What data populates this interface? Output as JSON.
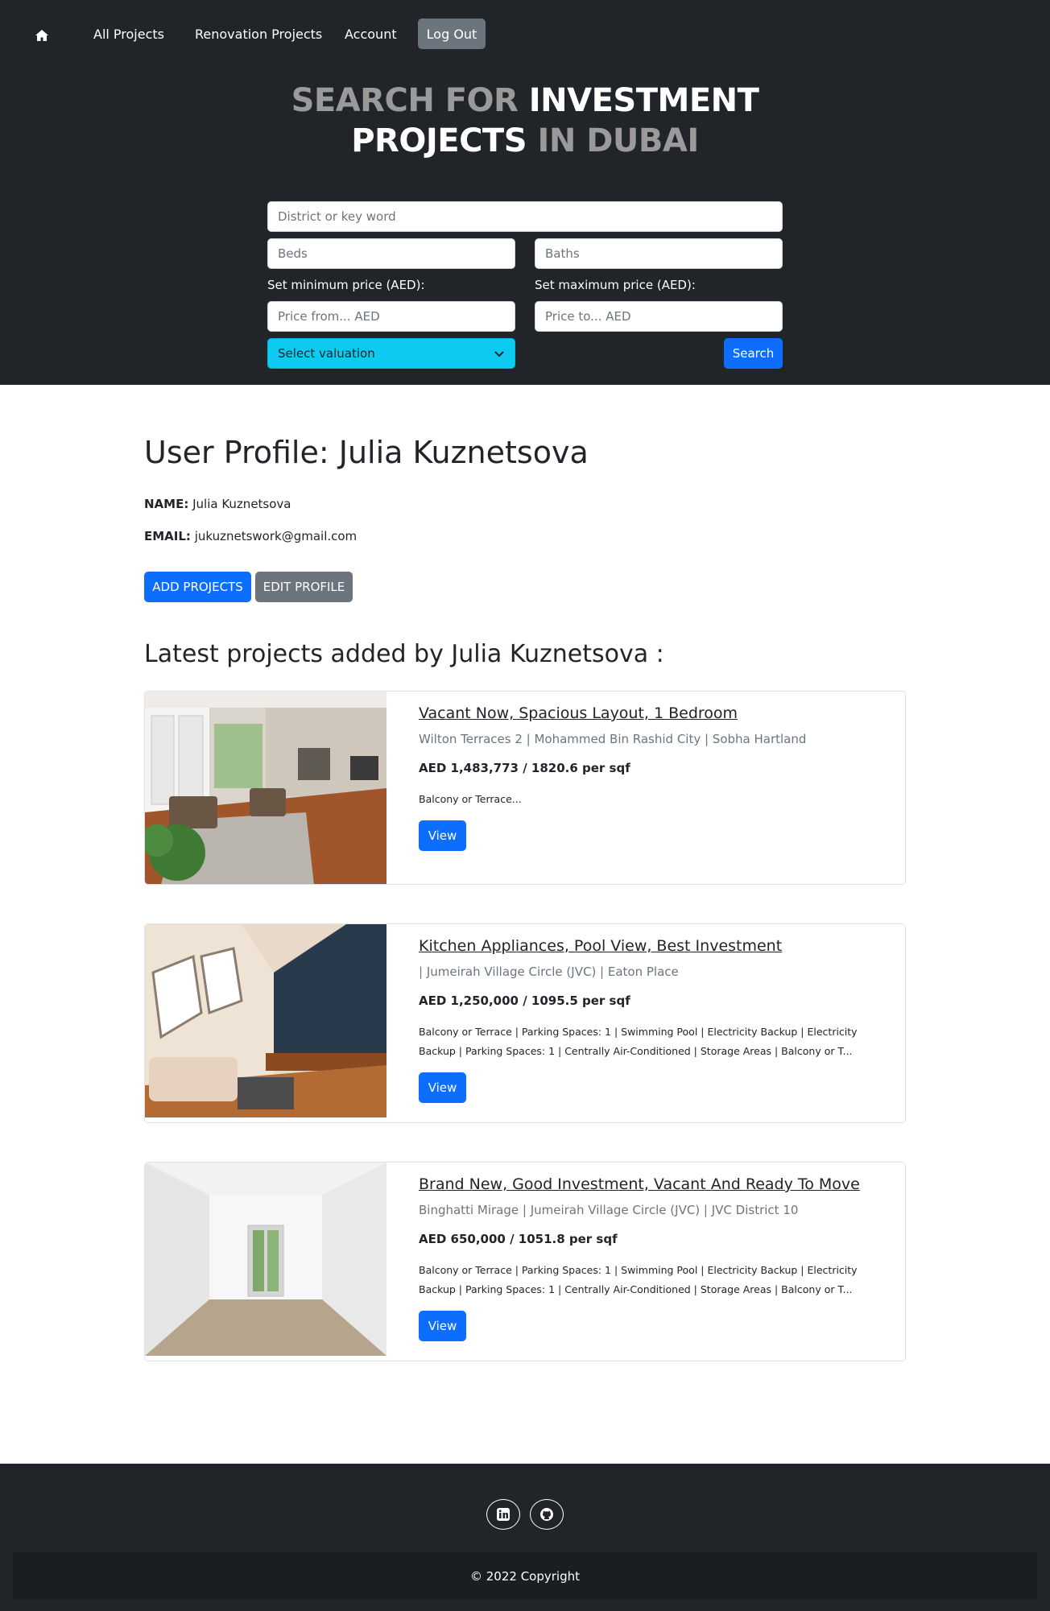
{
  "nav": {
    "home_icon": "home-icon",
    "links": [
      "All Projects",
      "Renovation Projects",
      "Account"
    ],
    "logout": "Log Out"
  },
  "hero": {
    "line1_muted": "SEARCH FOR ",
    "line1_bright": "INVESTMENT",
    "line2_bright": "PROJECTS",
    "line2_muted": " IN DUBAI"
  },
  "search": {
    "keyword_placeholder": "District or key word",
    "beds_placeholder": "Beds",
    "baths_placeholder": "Baths",
    "min_label": "Set minimum price (AED):",
    "max_label": "Set maximum price (AED):",
    "min_placeholder": "Price from... AED",
    "max_placeholder": "Price to... AED",
    "valuation_selected": "Select valuation",
    "search_label": "Search"
  },
  "profile": {
    "title": "User Profile: Julia Kuznetsova",
    "name_label": "NAME:",
    "name_value": " Julia Kuznetsova",
    "email_label": "EMAIL:",
    "email_value": " jukuznetswork@gmail.com",
    "add_projects": "ADD PROJECTS",
    "edit_profile": "EDIT PROFILE",
    "latest_title": "Latest projects added by Julia Kuznetsova :"
  },
  "projects": [
    {
      "title": "Vacant Now, Spacious Layout, 1 Bedroom",
      "location": "Wilton Terraces 2 | Mohammed Bin Rashid City | Sobha Hartland",
      "price": "AED 1,483,773 / 1820.6 per sqf",
      "description": "Balcony or Terrace...",
      "view": "View"
    },
    {
      "title": "Kitchen Appliances, Pool View, Best Investment",
      "location": "| Jumeirah Village Circle (JVC) | Eaton Place",
      "price": "AED 1,250,000 / 1095.5 per sqf",
      "description": "Balcony or Terrace | Parking Spaces: 1 | Swimming Pool | Electricity Backup | Electricity Backup | Parking Spaces: 1 | Centrally Air-Conditioned | Storage Areas | Balcony or T...",
      "view": "View"
    },
    {
      "title": "Brand New, Good Investment, Vacant And Ready To Move",
      "location": "Binghatti Mirage | Jumeirah Village Circle (JVC) | JVC District 10",
      "price": "AED 650,000 / 1051.8 per sqf",
      "description": "Balcony or Terrace | Parking Spaces: 1 | Swimming Pool | Electricity Backup | Electricity Backup | Parking Spaces: 1 | Centrally Air-Conditioned | Storage Areas | Balcony or T...",
      "view": "View"
    }
  ],
  "footer": {
    "social_icons": [
      "linkedin-icon",
      "github-icon"
    ],
    "copyright": "© 2022 Copyright"
  },
  "colors": {
    "dark": "#212529",
    "primary": "#0d6efd",
    "secondary": "#6c757d",
    "info": "#0dcaf0"
  }
}
